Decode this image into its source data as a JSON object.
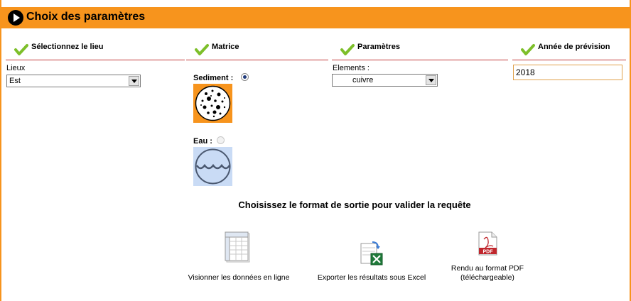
{
  "header": {
    "title": "Choix des paramètres"
  },
  "columns": [
    {
      "label": "Sélectionnez le lieu"
    },
    {
      "label": "Matrice"
    },
    {
      "label": "Paramètres"
    },
    {
      "label": "Année de prévision"
    }
  ],
  "lieu": {
    "field_label": "Lieux",
    "selected": "Est"
  },
  "matrice": {
    "options": [
      {
        "label": "Sediment :",
        "selected": true,
        "icon": "sediment-icon"
      },
      {
        "label": "Eau :",
        "selected": false,
        "icon": "water-wave-icon"
      }
    ]
  },
  "parametres": {
    "field_label": "Elements :",
    "selected": "cuivre"
  },
  "annee": {
    "value": "2018"
  },
  "output": {
    "prompt": "Choisissez le format de sortie pour valider la requête",
    "formats": [
      {
        "label": "Visionner les données en ligne",
        "icon": "spreadsheet-icon"
      },
      {
        "label": "Exporter les résultats sous Excel",
        "icon": "excel-export-icon"
      },
      {
        "label_line1": "Rendu au format PDF",
        "label_line2": "(téléchargeable)",
        "icon": "pdf-icon"
      }
    ]
  },
  "colors": {
    "accent": "#f7941d",
    "rule": "#c23b3b",
    "check": "#7dbf2a"
  }
}
